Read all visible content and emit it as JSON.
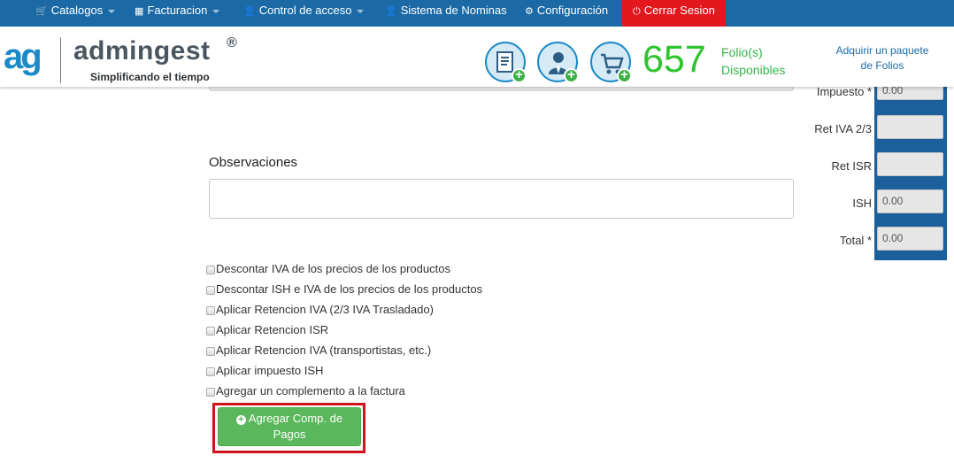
{
  "nav": {
    "catalogos": "Catalogos",
    "facturacion": "Facturacion",
    "control_acceso": "Control de acceso",
    "nominas": "Sistema de Nominas",
    "configuracion": "Configuración",
    "cerrar_sesion": "Cerrar Sesion"
  },
  "brand": {
    "mark": "ag",
    "name": "admingest",
    "registered": "®",
    "tagline": "Simplificando el tiempo"
  },
  "folios": {
    "count": "657",
    "label_line1": "Folio(s)",
    "label_line2": "Disponibles",
    "buy_line1": "Adquirir un paquete",
    "buy_line2": "de Folios"
  },
  "form": {
    "observaciones_label": "Observaciones",
    "observaciones_value": "",
    "options": [
      "Descontar IVA de los precios de los productos",
      "Descontar ISH e IVA de los precios de los productos",
      "Aplicar Retencion IVA (2/3 IVA Trasladado)",
      "Aplicar Retencion ISR",
      "Aplicar Retencion IVA (transportistas, etc.)",
      "Aplicar impuesto ISH",
      "Agregar un complemento a la factura"
    ],
    "button_line1": "Agregar Comp. de",
    "button_line2": "Pagos"
  },
  "totals": {
    "impuesto_label": "Impuesto *",
    "impuesto_value": "0.00",
    "ret_iva_label": "Ret IVA 2/3",
    "ret_iva_value": "",
    "ret_isr_label": "Ret ISR",
    "ret_isr_value": "",
    "ish_label": "ISH",
    "ish_value": "0.00",
    "total_label": "Total *",
    "total_value": "0.00"
  },
  "colors": {
    "nav_bg": "#1b6aa5",
    "logout_bg": "#e3171e",
    "folio_green": "#2ec42e",
    "button_green": "#5bb75b",
    "highlight_red": "#d0121b"
  },
  "icons": [
    "cart-icon",
    "qrcode-icon",
    "user-icon",
    "user-icon",
    "gear-icon",
    "power-icon",
    "invoice-add-icon",
    "client-add-icon",
    "cart-add-icon"
  ]
}
